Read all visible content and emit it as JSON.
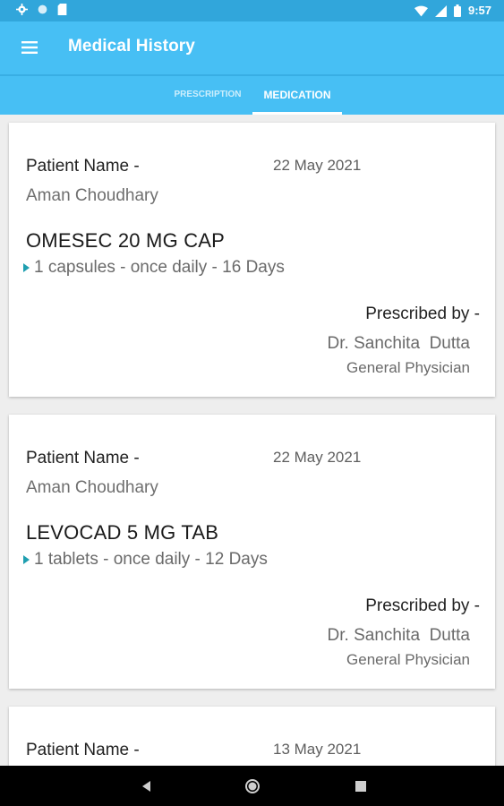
{
  "status_bar": {
    "time": "9:57",
    "icons": [
      "gear-icon",
      "circle-icon",
      "sd-card-icon",
      "wifi-icon",
      "signal-icon",
      "battery-icon"
    ]
  },
  "app_bar": {
    "title": "Medical History",
    "menu_icon": "hamburger-menu-icon"
  },
  "tabs": [
    {
      "label": "PRESCRIPTION",
      "selected": false
    },
    {
      "label": "MEDICATION",
      "selected": true
    }
  ],
  "cards": [
    {
      "patient_label": "Patient Name -",
      "date": "22 May 2021",
      "patient_name": "Aman Choudhary",
      "medicine": "OMESEC 20 MG CAP",
      "dosage": "1 capsules - once daily - 16 Days",
      "prescribed_label": "Prescribed by -",
      "doctor": "Dr. Sanchita  Dutta",
      "specialty": "General Physician"
    },
    {
      "patient_label": "Patient Name -",
      "date": "22 May 2021",
      "patient_name": "Aman Choudhary",
      "medicine": "LEVOCAD 5 MG TAB",
      "dosage": "1 tablets - once daily - 12 Days",
      "prescribed_label": "Prescribed by -",
      "doctor": "Dr. Sanchita  Dutta",
      "specialty": "General Physician"
    },
    {
      "patient_label": "Patient Name -",
      "date": "13 May 2021"
    }
  ],
  "nav_bar": {
    "icons": [
      "back-icon",
      "home-icon",
      "recents-icon"
    ]
  },
  "colors": {
    "status_bar": "#31a6db",
    "app_bar": "#47bff4",
    "accent_marker": "#1f9fb0",
    "background": "#eeeeee"
  }
}
